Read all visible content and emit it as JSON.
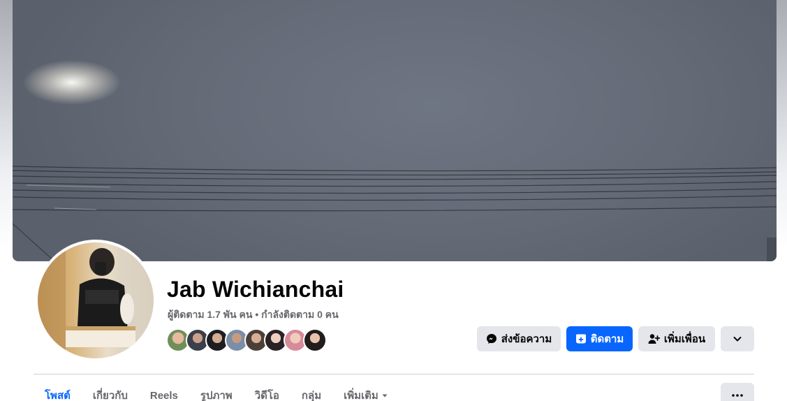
{
  "profile": {
    "name": "Jab Wichianchai",
    "stats": "ผู้ติดตาม 1.7 พัน คน • กำลังติดตาม 0 คน"
  },
  "actions": {
    "message_label": "ส่งข้อความ",
    "follow_label": "ติดตาม",
    "add_friend_label": "เพิ่มเพื่อน"
  },
  "tabs": [
    {
      "label": "โพสต์",
      "active": true
    },
    {
      "label": "เกี่ยวกับ"
    },
    {
      "label": "Reels"
    },
    {
      "label": "รูปภาพ"
    },
    {
      "label": "วิดีโอ"
    },
    {
      "label": "กลุ่ม"
    },
    {
      "label": "เพิ่มเติม"
    }
  ],
  "colors": {
    "accent": "#0866ff",
    "button_bg": "#e4e6eb",
    "secondary_text": "#65676b"
  },
  "icons": {
    "message": "messenger-icon",
    "follow": "follow-icon",
    "add_friend": "add-friend-icon",
    "dropdown": "chevron-down-icon",
    "more": "more-dots-icon",
    "tab_more": "caret-down-icon"
  }
}
